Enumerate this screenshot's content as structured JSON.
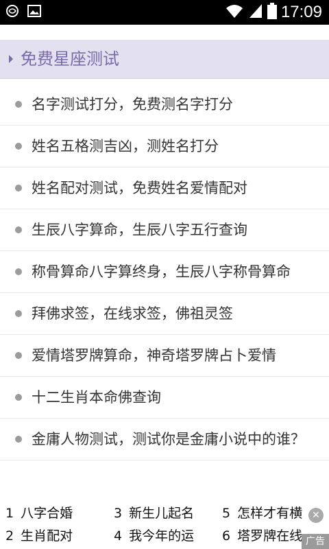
{
  "status_bar": {
    "time": "17:09",
    "icons": [
      "notification-icon",
      "image-icon",
      "wifi-icon",
      "signal-icon",
      "battery-icon"
    ]
  },
  "section": {
    "title": "免费星座测试"
  },
  "list": {
    "items": [
      "名字测试打分，免费测名字打分",
      "姓名五格测吉凶，测姓名打分",
      "姓名配对测试，免费姓名爱情配对",
      "生辰八字算命，生辰八字五行查询",
      "称骨算命八字算终身，生辰八字称骨算命",
      "拜佛求签，在线求签，佛祖灵签",
      "爱情塔罗牌算命，神奇塔罗牌占卜爱情",
      "十二生肖本命佛查询",
      "金庸人物测试，测试你是金庸小说中的谁？"
    ]
  },
  "ad": {
    "cells": [
      {
        "num": "1",
        "label": "八字合婚"
      },
      {
        "num": "2",
        "label": "生肖配对"
      },
      {
        "num": "3",
        "label": "新生儿起名"
      },
      {
        "num": "4",
        "label": "我今年的运"
      },
      {
        "num": "5",
        "label": "怎样才有横"
      },
      {
        "num": "6",
        "label": "塔罗牌在线"
      }
    ],
    "badge": "广告",
    "close_icon": "close-icon"
  },
  "colors": {
    "header_bg": "#e3e1ef",
    "header_text": "#7a6aa6",
    "list_text": "#333333",
    "bullet": "#9b9b9b"
  }
}
